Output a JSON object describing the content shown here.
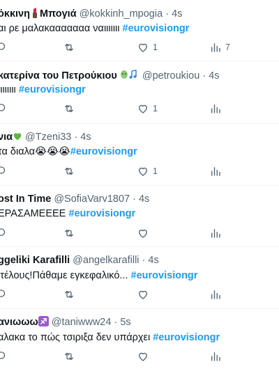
{
  "tweets": [
    {
      "display_name": "όκκινη",
      "emoji": "lipstick",
      "display_name2": "Μπογιά",
      "handle": "@kokkinh_mpogia",
      "time": "4s",
      "text": "αι ρε μαλακααααααα ναιιιιιιι",
      "hashtag": "#eurovisiongr",
      "likes": "1",
      "views": "7"
    },
    {
      "display_name": "κατερίνα του Πετρούκιου",
      "emoji": "masks-notes",
      "handle": "@petroukiou",
      "time": "4s",
      "text": "ιιιιιιιι",
      "hashtag": "#eurovisiongr",
      "likes": "1",
      "views": ""
    },
    {
      "display_name": "νια",
      "emoji": "green-heart",
      "handle": "@Tzeni33",
      "time": "4s",
      "text": "τα διαλα",
      "crying": "😭😭😭",
      "hashtag": "#eurovisiongr",
      "likes": "1",
      "views": ""
    },
    {
      "display_name": "ost In Time",
      "handle": "@SofiaVarv1807",
      "time": "4s",
      "text": "ΕΡΑΣΑΜΕΕΕΕ",
      "hashtag": "#eurovisiongr",
      "likes": "",
      "views": ""
    },
    {
      "display_name": "ggeliki Karafilli",
      "handle": "@angelkarafilli",
      "time": "4s",
      "text": "ιτέλους!Πάθαμε εγκεφαλικό...",
      "hashtag": "#eurovisiongr",
      "likes": "",
      "views": ""
    },
    {
      "display_name": "ανιωωω",
      "emoji": "sagittarius",
      "handle": "@taniwww24",
      "time": "5s",
      "text": "αλακα το πώς τσιριξα δεν υπάρχει",
      "hashtag": "#eurovisiongr",
      "likes": "",
      "views": ""
    }
  ],
  "separator": "·",
  "colors": {
    "hashtag": "#1d9bf0",
    "muted": "#536471",
    "text": "#0f1419",
    "divider": "#eff3f4"
  }
}
